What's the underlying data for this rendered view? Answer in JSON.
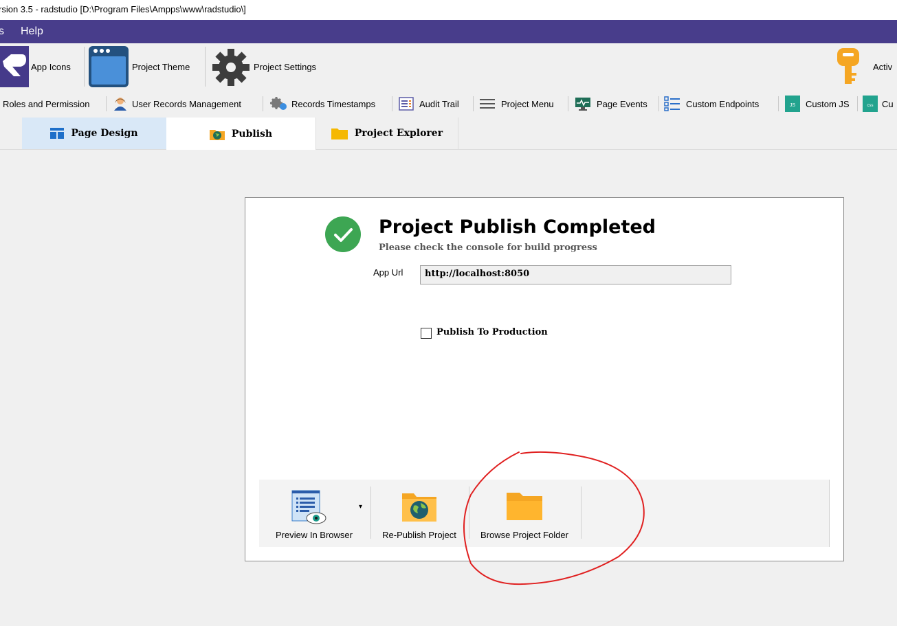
{
  "window": {
    "title": "rsion 3.5 - radstudio [D:\\Program Files\\Ampps\\www\\radstudio\\]"
  },
  "menu": {
    "items": [
      "s",
      "Help"
    ]
  },
  "toolbar": {
    "app_icons": "App Icons",
    "project_theme": "Project Theme",
    "project_settings": "Project Settings",
    "activate": "Activ"
  },
  "toolbar2": {
    "roles": "Roles and Permission",
    "user_records": "User Records Management",
    "records_timestamps": "Records Timestamps",
    "audit_trail": "Audit Trail",
    "project_menu": "Project Menu",
    "page_events": "Page Events",
    "custom_endpoints": "Custom Endpoints",
    "custom_js": "Custom JS",
    "custom_css": "Cu",
    "js_badge": "JS",
    "css_badge": "css"
  },
  "tabs": [
    {
      "label": "Page Design"
    },
    {
      "label": "Publish"
    },
    {
      "label": "Project Explorer"
    }
  ],
  "publish": {
    "title": "Project Publish Completed",
    "subtitle": "Please check the console for build progress",
    "app_url_label": "App Url",
    "app_url_value": "http://localhost:8050",
    "production_label": "Publish To Production",
    "production_checked": false
  },
  "actions": {
    "preview": "Preview In Browser",
    "republish": "Re-Publish Project",
    "browse": "Browse Project Folder"
  },
  "colors": {
    "menubar": "#483d8b",
    "success": "#3da653",
    "folder": "#f5a623",
    "annotation": "#e02020"
  }
}
